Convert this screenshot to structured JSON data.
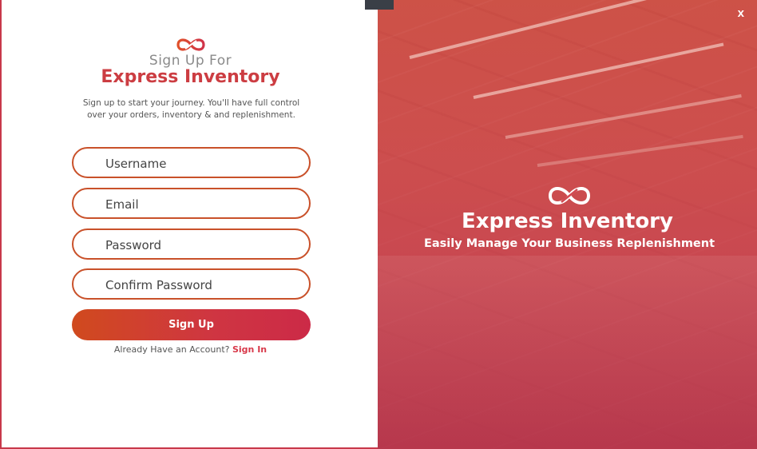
{
  "signup": {
    "heading_line1": "Sign Up For",
    "heading_line2": "Express Inventory",
    "description": "Sign up to start your journey. You'll have full control over your orders, inventory & and replenishment.",
    "fields": {
      "username_placeholder": "Username",
      "email_placeholder": "Email",
      "password_placeholder": "Password",
      "confirm_password_placeholder": "Confirm Password"
    },
    "button_label": "Sign Up",
    "already_text": "Already Have an Account?",
    "signin_link": "Sign In"
  },
  "hero": {
    "title": "Express Inventory",
    "tagline": "Easily Manage Your Business Replenishment"
  },
  "window": {
    "close_label": "x"
  },
  "colors": {
    "accent": "#cc3d42",
    "field_border": "#c9512a",
    "button_gradient_start": "#d04a1e",
    "button_gradient_end": "#cc2a47",
    "hero_overlay": "#cd4652"
  },
  "icons": {
    "logo": "infinity-logo-icon",
    "close": "close-icon"
  }
}
